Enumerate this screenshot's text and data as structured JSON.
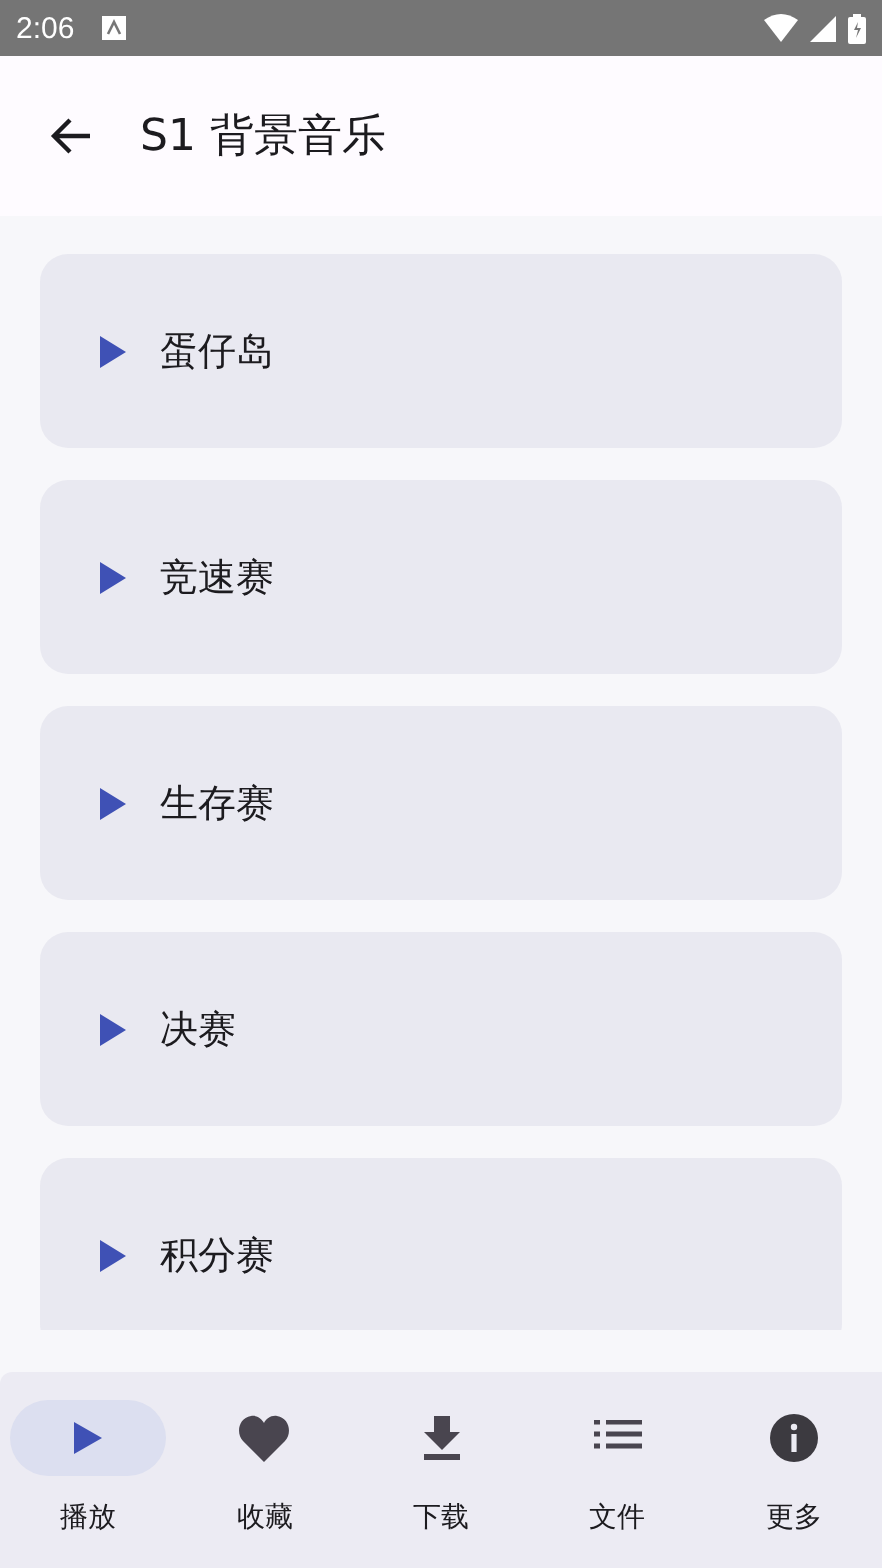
{
  "status_bar": {
    "time": "2:06"
  },
  "app_bar": {
    "title": "S1 背景音乐"
  },
  "tracks": [
    {
      "name": "蛋仔岛"
    },
    {
      "name": "竞速赛"
    },
    {
      "name": "生存赛"
    },
    {
      "name": "决赛"
    },
    {
      "name": "积分赛"
    }
  ],
  "bottom_nav": [
    {
      "label": "播放",
      "selected": true
    },
    {
      "label": "收藏",
      "selected": false
    },
    {
      "label": "下载",
      "selected": false
    },
    {
      "label": "文件",
      "selected": false
    },
    {
      "label": "更多",
      "selected": false
    }
  ]
}
